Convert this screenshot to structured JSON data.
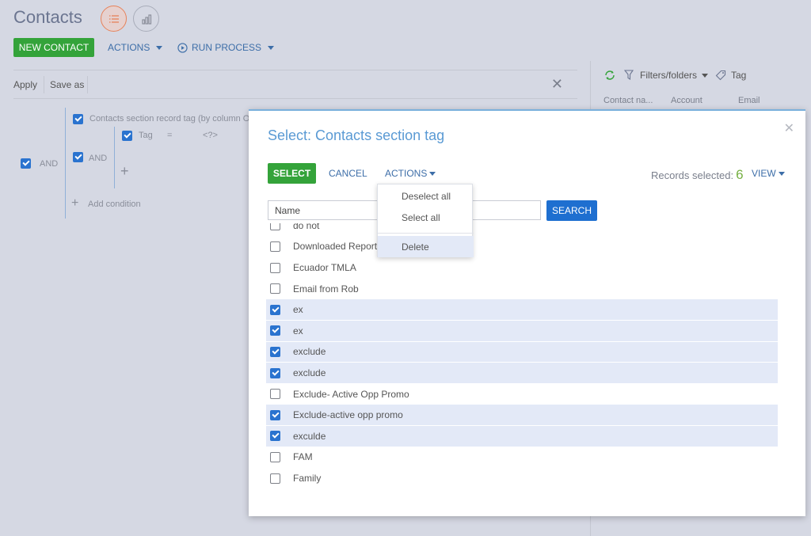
{
  "page": {
    "title": "Contacts",
    "new_contact": "NEW CONTACT",
    "actions": "ACTIONS",
    "run_process": "RUN PROCESS",
    "apply": "Apply",
    "save_as": "Save as",
    "and1": "AND",
    "and2": "AND",
    "condition_group": "Contacts section record tag (by column Ob",
    "tag_label": "Tag",
    "tag_operator": "=",
    "tag_value": "<?>",
    "add_condition": "Add condition"
  },
  "right_panel": {
    "filters_folders": "Filters/folders",
    "tag": "Tag",
    "col_contact": "Contact na...",
    "col_account": "Account",
    "col_email": "Email"
  },
  "modal": {
    "title": "Select: Contacts section tag",
    "select": "SELECT",
    "cancel": "CANCEL",
    "actions": "ACTIONS",
    "records_label": "Records selected:",
    "records_count": "6",
    "view": "VIEW",
    "search_placeholder": "Name",
    "search_button": "SEARCH",
    "items": [
      {
        "label": "do not",
        "checked": false
      },
      {
        "label": "Downloaded Report",
        "checked": false
      },
      {
        "label": "Ecuador TMLA",
        "checked": false
      },
      {
        "label": "Email from Rob",
        "checked": false
      },
      {
        "label": "ex",
        "checked": true
      },
      {
        "label": "ex",
        "checked": true
      },
      {
        "label": "exclude",
        "checked": true
      },
      {
        "label": "exclude",
        "checked": true
      },
      {
        "label": "Exclude- Active Opp Promo",
        "checked": false
      },
      {
        "label": "Exclude-active opp promo",
        "checked": true
      },
      {
        "label": "exculde",
        "checked": true
      },
      {
        "label": "FAM",
        "checked": false
      },
      {
        "label": "Family",
        "checked": false
      }
    ]
  },
  "actions_menu": {
    "deselect_all": "Deselect all",
    "select_all": "Select all",
    "delete": "Delete"
  },
  "colors": {
    "accent_green": "#34a33a",
    "accent_blue": "#1e6fd0",
    "selected_row": "#e3e9f7"
  }
}
